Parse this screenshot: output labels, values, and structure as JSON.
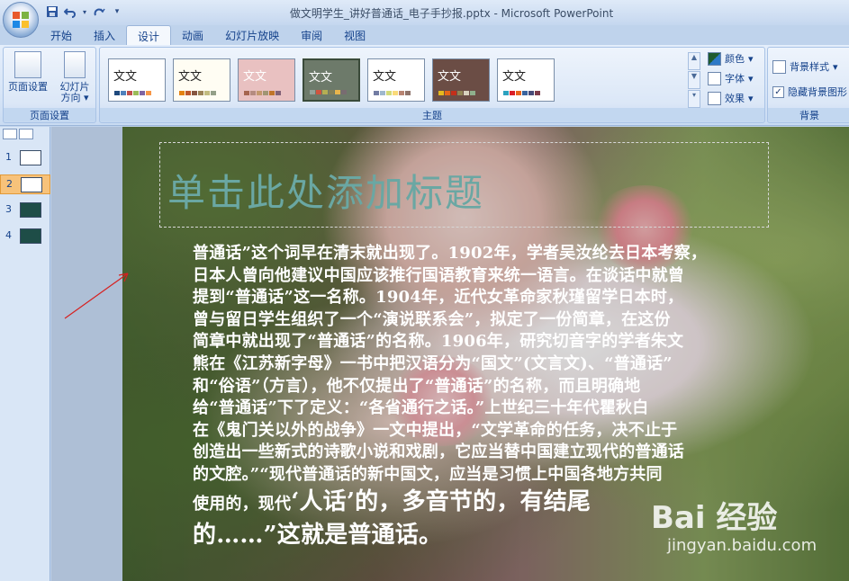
{
  "window": {
    "title": "做文明学生_讲好普通话_电子手抄报.pptx - Microsoft PowerPoint"
  },
  "tabs": [
    {
      "label": "开始"
    },
    {
      "label": "插入"
    },
    {
      "label": "设计"
    },
    {
      "label": "动画"
    },
    {
      "label": "幻灯片放映"
    },
    {
      "label": "审阅"
    },
    {
      "label": "视图"
    }
  ],
  "ribbon": {
    "page_setup": {
      "page_setup_label": "页面设置",
      "orientation_label_1": "幻灯片",
      "orientation_label_2": "方向",
      "group_label": "页面设置"
    },
    "themes": {
      "group_label": "主题",
      "items": [
        {
          "text": "文文",
          "bg": "#ffffff"
        },
        {
          "text": "文文",
          "bg": "#fffdf3"
        },
        {
          "text": "文文",
          "bg": "#e9c1c1"
        },
        {
          "text": "文文",
          "bg": "#6d7a6a"
        },
        {
          "text": "文文",
          "bg": "#ffffff"
        },
        {
          "text": "文文",
          "bg": "#6b4d45"
        },
        {
          "text": "文文",
          "bg": "#ffffff"
        }
      ],
      "colors_label": "颜色",
      "fonts_label": "字体",
      "effects_label": "效果"
    },
    "background": {
      "styles_label": "背景样式",
      "hide_label": "隐藏背景图形",
      "group_label": "背景"
    }
  },
  "slides_pane": {
    "thumbnails": [
      {
        "num": "1",
        "color": "#ffffff"
      },
      {
        "num": "2",
        "color": "#ffffff"
      },
      {
        "num": "3",
        "color": "#1e4d47"
      },
      {
        "num": "4",
        "color": "#1e4d47"
      }
    ],
    "selected_index": 2
  },
  "slide": {
    "title_placeholder": "单击此处添加标题",
    "body_lines": [
      "普通话”这个词早在清末就出现了。1902年，学者吴汝纶去日本考察，",
      "日本人曾向他建议中国应该推行国语教育来统一语言。在谈话中就曾",
      "提到“普通话”这一名称。1904年，近代女革命家秋瑾留学日本时，",
      "曾与留日学生组织了一个“演说联系会”，拟定了一份简章，在这份",
      "简章中就出现了“普通话”的名称。1906年，研究切音字的学者朱文",
      "熊在《江苏新字母》一书中把汉语分为“国文”(文言文)、“普通话”",
      "和“俗语”（方言），他不仅提出了“普通话”的名称，而且明确地",
      "给“普通话”下了定义：“各省通行之话。”上世纪三十年代瞿秋白",
      "在《鬼门关以外的战争》一文中提出，“文学革命的任务，决不止于",
      "创造出一些新式的诗歌小说和戏剧，它应当替中国建立现代的普通话",
      "的文腔。”“现代普通话的新中国文，应当是习惯上中国各地方共同"
    ],
    "body_line_small": "使用的，现代",
    "body_line_big_1": "‘人话’的，多音节的，有结尾",
    "body_line_big_2": "的……”这就是普通话。"
  },
  "watermark": {
    "logo_text": "Bai 经验",
    "url_text": "jingyan.baidu.com"
  }
}
